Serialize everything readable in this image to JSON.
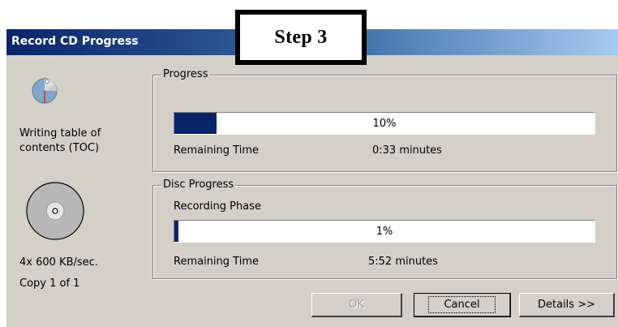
{
  "window": {
    "title": "Record CD Progress"
  },
  "callout": {
    "label": "Step 3"
  },
  "status": {
    "line1": "Writing table of",
    "line2": "contents (TOC)"
  },
  "speed": {
    "text": "4x 600 KB/sec."
  },
  "copy": {
    "text": "Copy 1 of 1"
  },
  "progress": {
    "label": "Progress",
    "percent_text": "10%",
    "fraction": 0.1,
    "remaining_label": "Remaining Time",
    "remaining_value": "0:33 minutes"
  },
  "disc_progress": {
    "label": "Disc Progress",
    "phase": "Recording Phase",
    "percent_text": "1%",
    "fraction": 0.01,
    "remaining_label": "Remaining Time",
    "remaining_value": "5:52 minutes"
  },
  "buttons": {
    "ok": "OK",
    "cancel": "Cancel",
    "details": "Details >>"
  },
  "colors": {
    "title_gradient_start": "#0a246a",
    "progress_fill": "#0a246a",
    "dialog_bg": "#d4d0c8"
  },
  "icons": {
    "status": "cd-write-icon",
    "disc": "disc-icon"
  }
}
